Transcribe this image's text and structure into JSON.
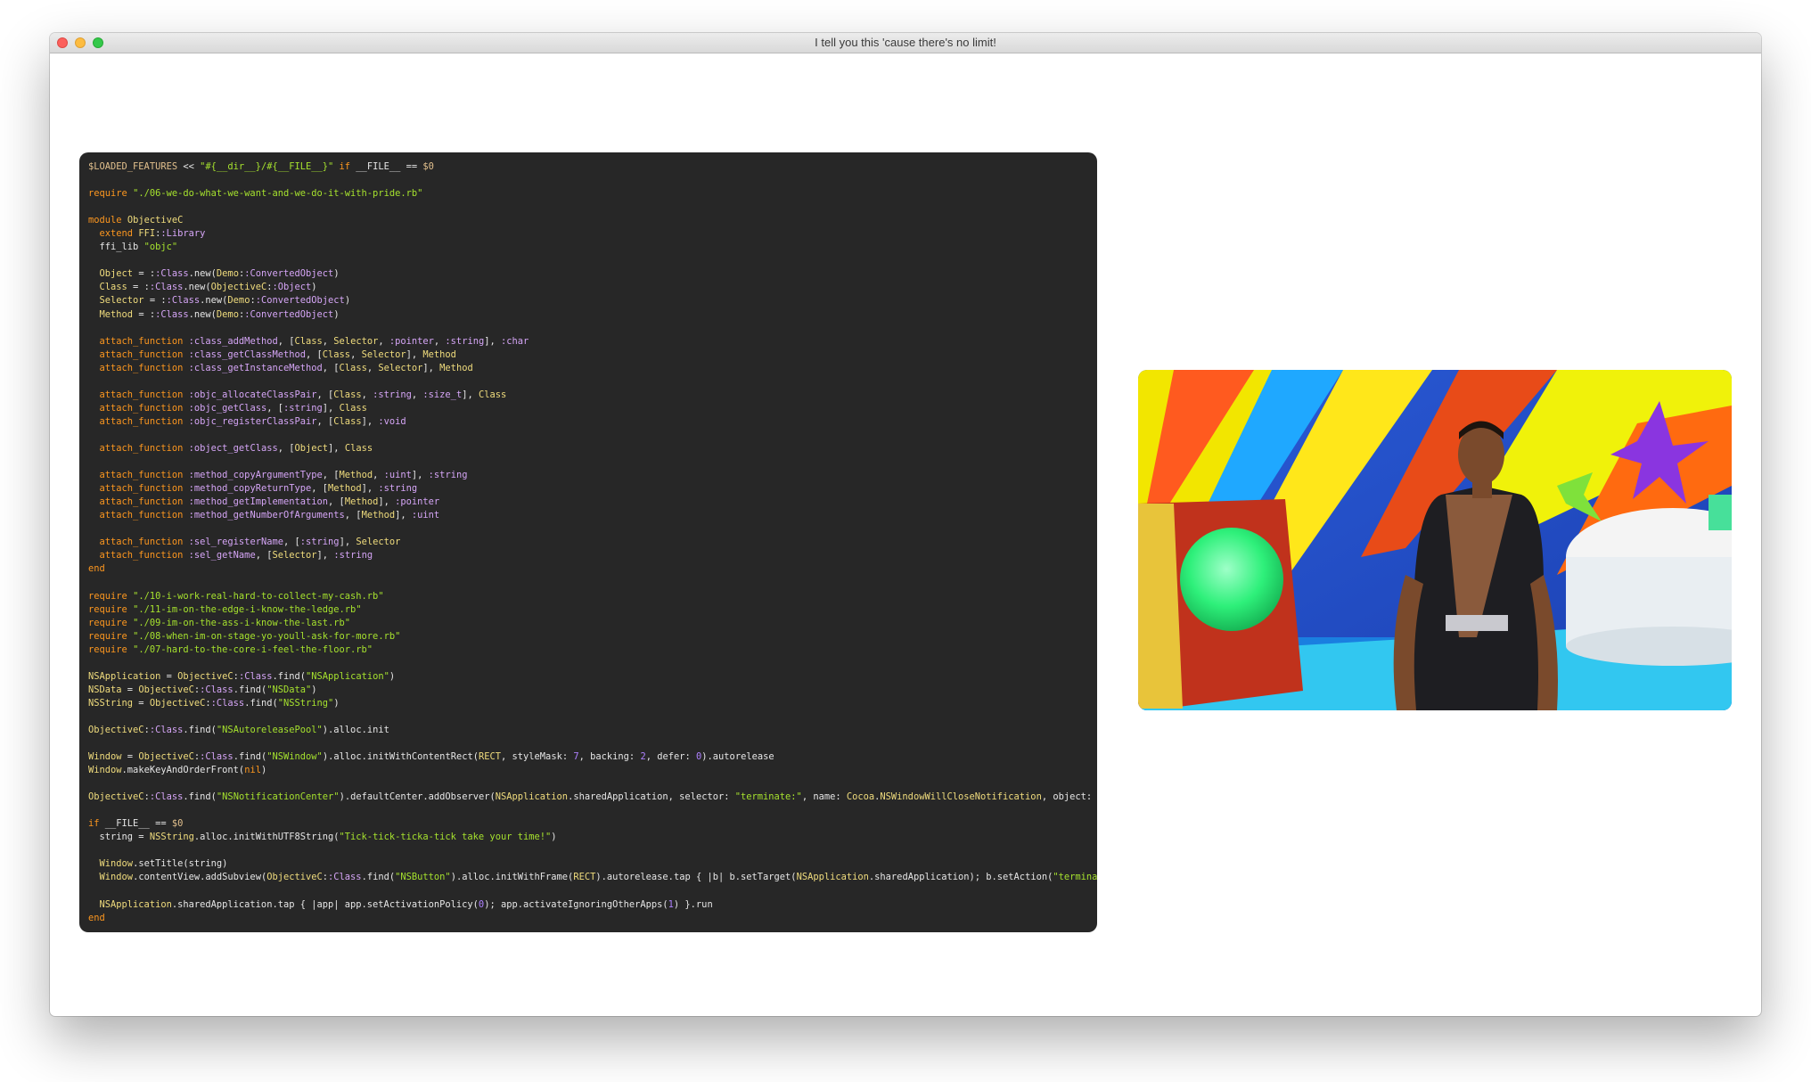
{
  "window": {
    "title": "I tell you this 'cause there's no limit!"
  },
  "code_panel": {
    "lines": [
      "$LOADED_FEATURES << \"#{__dir__}/#{__FILE__}\" if __FILE__ == $0",
      "",
      "require \"./06-we-do-what-we-want-and-we-do-it-with-pride.rb\"",
      "",
      "module ObjectiveC",
      "  extend FFI::Library",
      "  ffi_lib \"objc\"",
      "",
      "  Object = ::Class.new(Demo::ConvertedObject)",
      "  Class = ::Class.new(ObjectiveC::Object)",
      "  Selector = ::Class.new(Demo::ConvertedObject)",
      "  Method = ::Class.new(Demo::ConvertedObject)",
      "",
      "  attach_function :class_addMethod, [Class, Selector, :pointer, :string], :char",
      "  attach_function :class_getClassMethod, [Class, Selector], Method",
      "  attach_function :class_getInstanceMethod, [Class, Selector], Method",
      "",
      "  attach_function :objc_allocateClassPair, [Class, :string, :size_t], Class",
      "  attach_function :objc_getClass, [:string], Class",
      "  attach_function :objc_registerClassPair, [Class], :void",
      "",
      "  attach_function :object_getClass, [Object], Class",
      "",
      "  attach_function :method_copyArgumentType, [Method, :uint], :string",
      "  attach_function :method_copyReturnType, [Method], :string",
      "  attach_function :method_getImplementation, [Method], :pointer",
      "  attach_function :method_getNumberOfArguments, [Method], :uint",
      "",
      "  attach_function :sel_registerName, [:string], Selector",
      "  attach_function :sel_getName, [Selector], :string",
      "end",
      "",
      "require \"./10-i-work-real-hard-to-collect-my-cash.rb\"",
      "require \"./11-im-on-the-edge-i-know-the-ledge.rb\"",
      "require \"./09-im-on-the-ass-i-know-the-last.rb\"",
      "require \"./08-when-im-on-stage-yo-youll-ask-for-more.rb\"",
      "require \"./07-hard-to-the-core-i-feel-the-floor.rb\"",
      "",
      "NSApplication = ObjectiveC::Class.find(\"NSApplication\")",
      "NSData = ObjectiveC::Class.find(\"NSData\")",
      "NSString = ObjectiveC::Class.find(\"NSString\")",
      "",
      "ObjectiveC::Class.find(\"NSAutoreleasePool\").alloc.init",
      "",
      "Window = ObjectiveC::Class.find(\"NSWindow\").alloc.initWithContentRect(RECT, styleMask: 7, backing: 2, defer: 0).autorelease",
      "Window.makeKeyAndOrderFront(nil)",
      "",
      "ObjectiveC::Class.find(\"NSNotificationCenter\").defaultCenter.addObserver(NSApplication.sharedApplication, selector: \"terminate:\", name: Cocoa.NSWindowWillCloseNotification, object: Window)",
      "",
      "if __FILE__ == $0",
      "  string = NSString.alloc.initWithUTF8String(\"Tick-tick-ticka-tick take your time!\")",
      "",
      "  Window.setTitle(string)",
      "  Window.contentView.addSubview(ObjectiveC::Class.find(\"NSButton\").alloc.initWithFrame(RECT).autorelease.tap { |b| b.setTarget(NSApplication.sharedApplication); b.setAction(\"terminate:\"); b",
      "",
      "  NSApplication.sharedApplication.tap { |app| app.setActivationPolicy(0); app.activateIgnoringOtherApps(1) }.run",
      "end"
    ]
  },
  "video": {
    "icon": "music-video-frame"
  },
  "colors": {
    "code_bg": "#272727",
    "keyword": "#fd971f",
    "string": "#a6e22e",
    "constant": "#f0dc7d",
    "symbol": "#d5a5f6",
    "number": "#ae81ff"
  }
}
